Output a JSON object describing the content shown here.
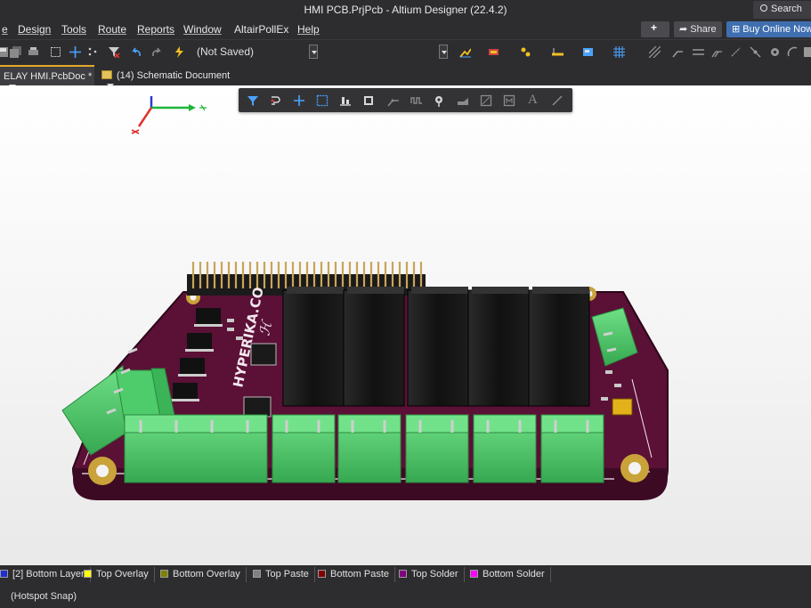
{
  "window": {
    "title": "HMI PCB.PrjPcb - Altium Designer (22.4.2)",
    "search_label": "Search"
  },
  "menu": {
    "items": [
      "e",
      "Design",
      "Tools",
      "Route",
      "Reports",
      "Window",
      "AltairPollEx",
      "Help"
    ],
    "share_label": "Share",
    "buy_label": "Buy Online Now"
  },
  "toolbar": {
    "status_text": "(Not Saved)"
  },
  "tabs": {
    "pcb_doc": "ELAY HMI.PcbDoc *",
    "schematic_doc": "(14) Schematic Document"
  },
  "active_bar": {
    "text_tool_label": "A"
  },
  "board": {
    "silkscreen_text": "HYPERIKA.CO",
    "colors": {
      "pcb": "#5b1036",
      "connector": "#4ecb6a",
      "relay": "#151515",
      "header_pins": "#c9a45a"
    }
  },
  "layers": [
    {
      "label": "[2] Bottom Layer",
      "color": "#1f2fd0"
    },
    {
      "label": "Top Overlay",
      "color": "#ffff00"
    },
    {
      "label": "Bottom Overlay",
      "color": "#808000"
    },
    {
      "label": "Top Paste",
      "color": "#808080"
    },
    {
      "label": "Bottom Paste",
      "color": "#800000"
    },
    {
      "label": "Top Solder",
      "color": "#800080"
    },
    {
      "label": "Bottom Solder",
      "color": "#ff00ff"
    }
  ],
  "status": {
    "text": "(Hotspot Snap)"
  }
}
